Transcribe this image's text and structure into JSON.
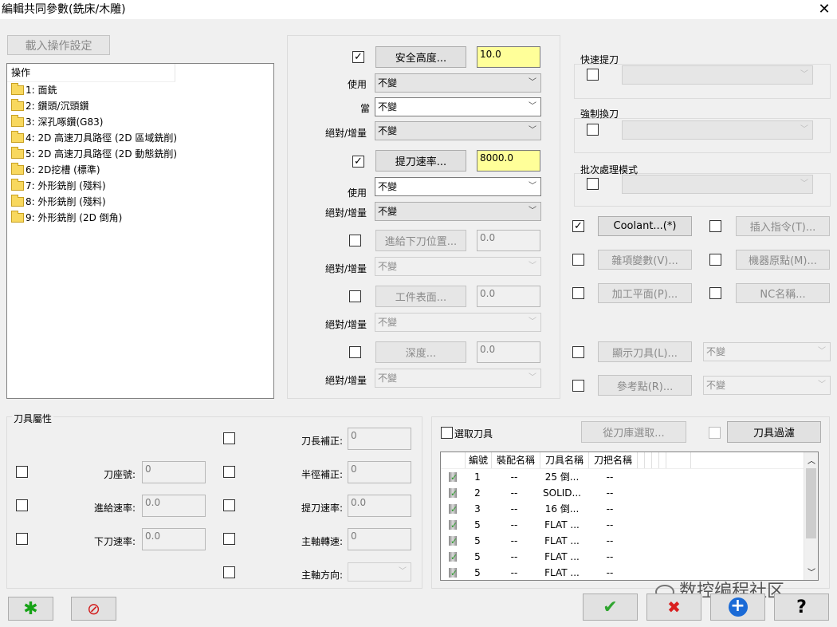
{
  "window": {
    "title": "編輯共同參數(銑床/木雕)",
    "close": "✕"
  },
  "load_button": "載入操作設定",
  "tree": {
    "header": "操作",
    "items": [
      "1: 面銑",
      "2: 鑽頭/沉頭鑽",
      "3: 深孔啄鑽(G83)",
      "4: 2D 高速刀具路徑 (2D 區域銑削)",
      "5: 2D 高速刀具路徑 (2D 動態銑削)",
      "6: 2D挖槽 (標準)",
      "7: 外形銑削 (殘料)",
      "8: 外形銑削 (殘料)",
      "9: 外形銑削 (2D 倒角)"
    ]
  },
  "middle": {
    "safety": {
      "check": "✓",
      "button": "安全高度...",
      "value": "10.0"
    },
    "use_label": "使用",
    "use_value": "不變",
    "when_label": "當",
    "when_value": "不變",
    "abs_label": "絕對/增量",
    "abs_value": "不變",
    "retract": {
      "check": "✓",
      "button": "提刀速率...",
      "value": "8000.0"
    },
    "use2_label": "使用",
    "use2_value": "不變",
    "abs2_label": "絕對/增量",
    "abs2_value": "不變",
    "feed_plane": {
      "button": "進給下刀位置...",
      "value": "0.0"
    },
    "abs3_label": "絕對/增量",
    "abs3_value": "不變",
    "top_stock": {
      "button": "工件表面...",
      "value": "0.0"
    },
    "abs4_label": "絕對/增量",
    "abs4_value": "不變",
    "depth": {
      "button": "深度...",
      "value": "0.0"
    },
    "abs5_label": "絕對/增量",
    "abs5_value": "不變"
  },
  "right": {
    "rapid_label": "快速提刀",
    "force_label": "強制換刀",
    "batch_label": "批次處理模式",
    "coolant": {
      "check": "✓",
      "label": "Coolant...(*)"
    },
    "insert": "插入指令(T)...",
    "misc": "雜項變數(V)...",
    "home": "機器原點(M)...",
    "plane": "加工平面(P)...",
    "nc": "NC名稱...",
    "display_tool": "顯示刀具(L)...",
    "display_value": "不變",
    "ref_point": "參考點(R)...",
    "ref_value": "不變"
  },
  "tool_props": {
    "title": "刀具屬性",
    "holder_label": "刀座號:",
    "holder_value": "0",
    "feed_label": "進給速率:",
    "feed_value": "0.0",
    "plunge_label": "下刀速率:",
    "plunge_value": "0.0",
    "len_label": "刀長補正:",
    "len_value": "0",
    "dia_label": "半徑補正:",
    "dia_value": "0",
    "retract_label": "提刀速率:",
    "retract_value": "0.0",
    "spindle_label": "主軸轉速:",
    "spindle_value": "0",
    "dir_label": "主軸方向:"
  },
  "tool_select": {
    "check_label": "選取刀具",
    "library_button": "從刀庫選取...",
    "filter_button": "刀具過濾",
    "columns": [
      "編號",
      "裝配名稱",
      "刀具名稱",
      "刀把名稱"
    ],
    "rows": [
      [
        "1",
        "--",
        "25 倒...",
        "--"
      ],
      [
        "2",
        "--",
        "SOLID...",
        "--"
      ],
      [
        "3",
        "--",
        "16 倒...",
        "--"
      ],
      [
        "5",
        "--",
        "FLAT ...",
        "--"
      ],
      [
        "5",
        "--",
        "FLAT ...",
        "--"
      ],
      [
        "5",
        "--",
        "FLAT ...",
        "--"
      ],
      [
        "5",
        "--",
        "FLAT ...",
        "--"
      ]
    ]
  },
  "watermark": "数控编程社区",
  "bottom": {
    "ok": "✔",
    "cancel": "✖",
    "add": "+",
    "help": "?",
    "new": "✱",
    "clear": "⊘"
  },
  "colors": {
    "ok": "#2fa52f",
    "cancel": "#d92020",
    "add": "#1a6ad6",
    "new": "#17a317",
    "clear": "#d21c1c",
    "highlight": "#ffff99"
  }
}
